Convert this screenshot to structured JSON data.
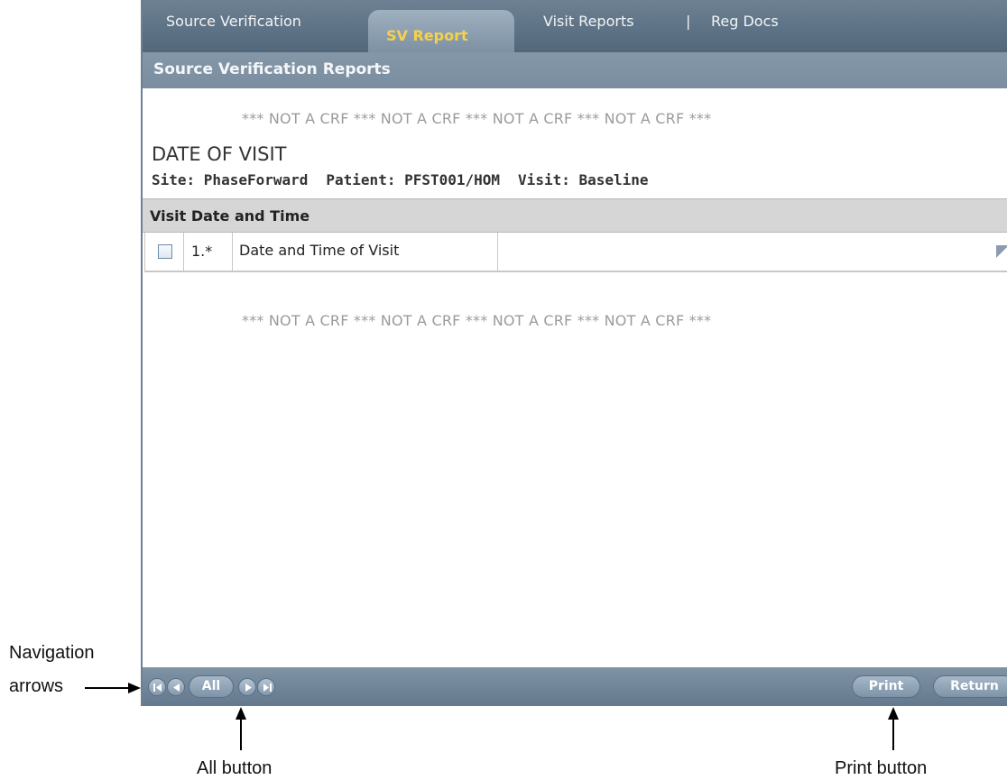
{
  "tabs": {
    "source_verification": "Source Verification",
    "sv_report": "SV Report",
    "separator": "|",
    "visit_reports": "Visit Reports",
    "reg_docs": "Reg Docs"
  },
  "subheader": {
    "title": "Source Verification Reports"
  },
  "banner": {
    "top": "*** NOT A CRF *** NOT A CRF *** NOT A CRF *** NOT A CRF ***",
    "bottom": "*** NOT A CRF *** NOT A CRF *** NOT A CRF *** NOT A CRF ***"
  },
  "form": {
    "title": "DATE OF VISIT",
    "site": "Site: PhaseForward",
    "patient": "Patient: PFST001/HOM",
    "visit": "Visit: Baseline"
  },
  "section": {
    "title": "Visit Date and Time"
  },
  "question": {
    "number": "1.*",
    "text": "Date and Time of Visit",
    "value": ""
  },
  "toolbar": {
    "all_label": "All",
    "print_label": "Print",
    "return_label": "Return"
  },
  "annotations": {
    "navigation_arrows_line1": "Navigation",
    "navigation_arrows_line2": "arrows",
    "all_button": "All button",
    "print_button": "Print button"
  },
  "colors": {
    "header_bg": "#5e7386",
    "active_tab_text": "#f6d14c",
    "banner_text": "#9b9b9b",
    "section_bg": "#d6d6d6"
  },
  "icons": {
    "first": "first-page-icon",
    "prev": "previous-page-icon",
    "next": "next-page-icon",
    "last": "last-page-icon",
    "flag": "flag-icon"
  }
}
